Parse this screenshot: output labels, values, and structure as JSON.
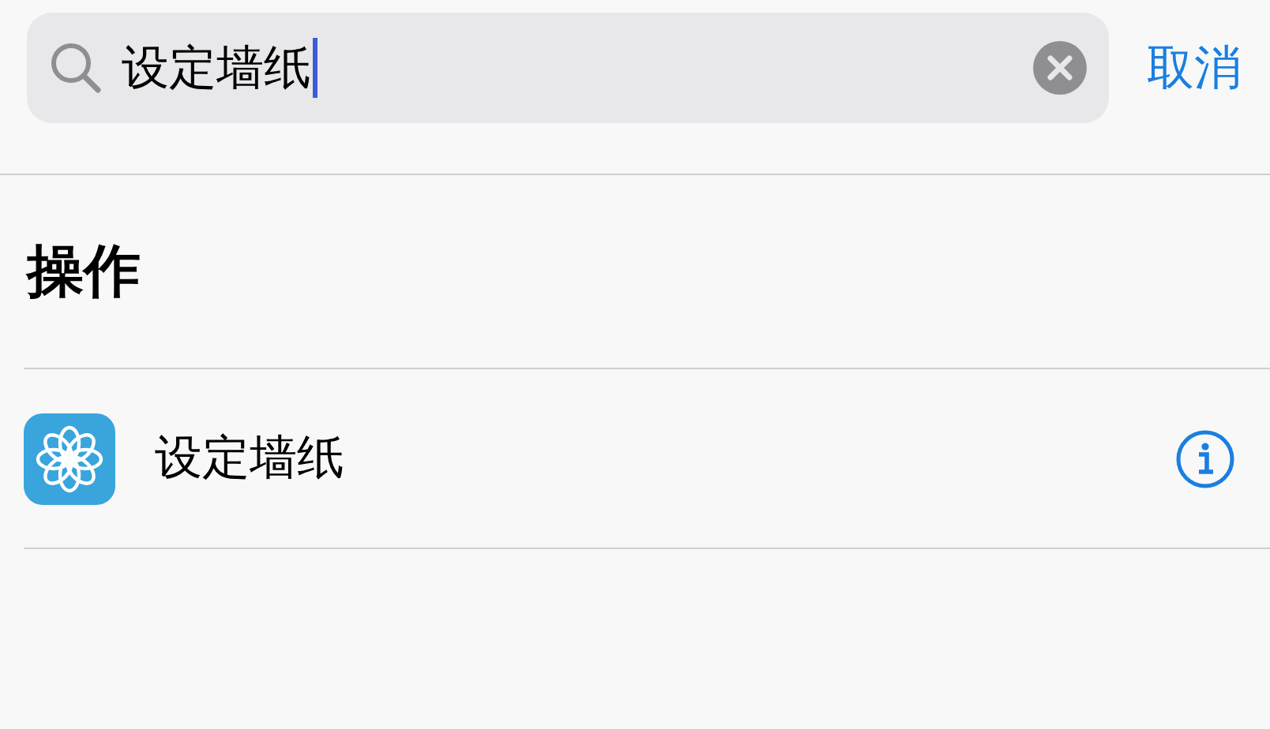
{
  "search": {
    "value": "设定墙纸",
    "focused": true
  },
  "cancel": "取消",
  "section": {
    "title": "操作",
    "actions": [
      {
        "label": "设定墙纸"
      }
    ]
  }
}
